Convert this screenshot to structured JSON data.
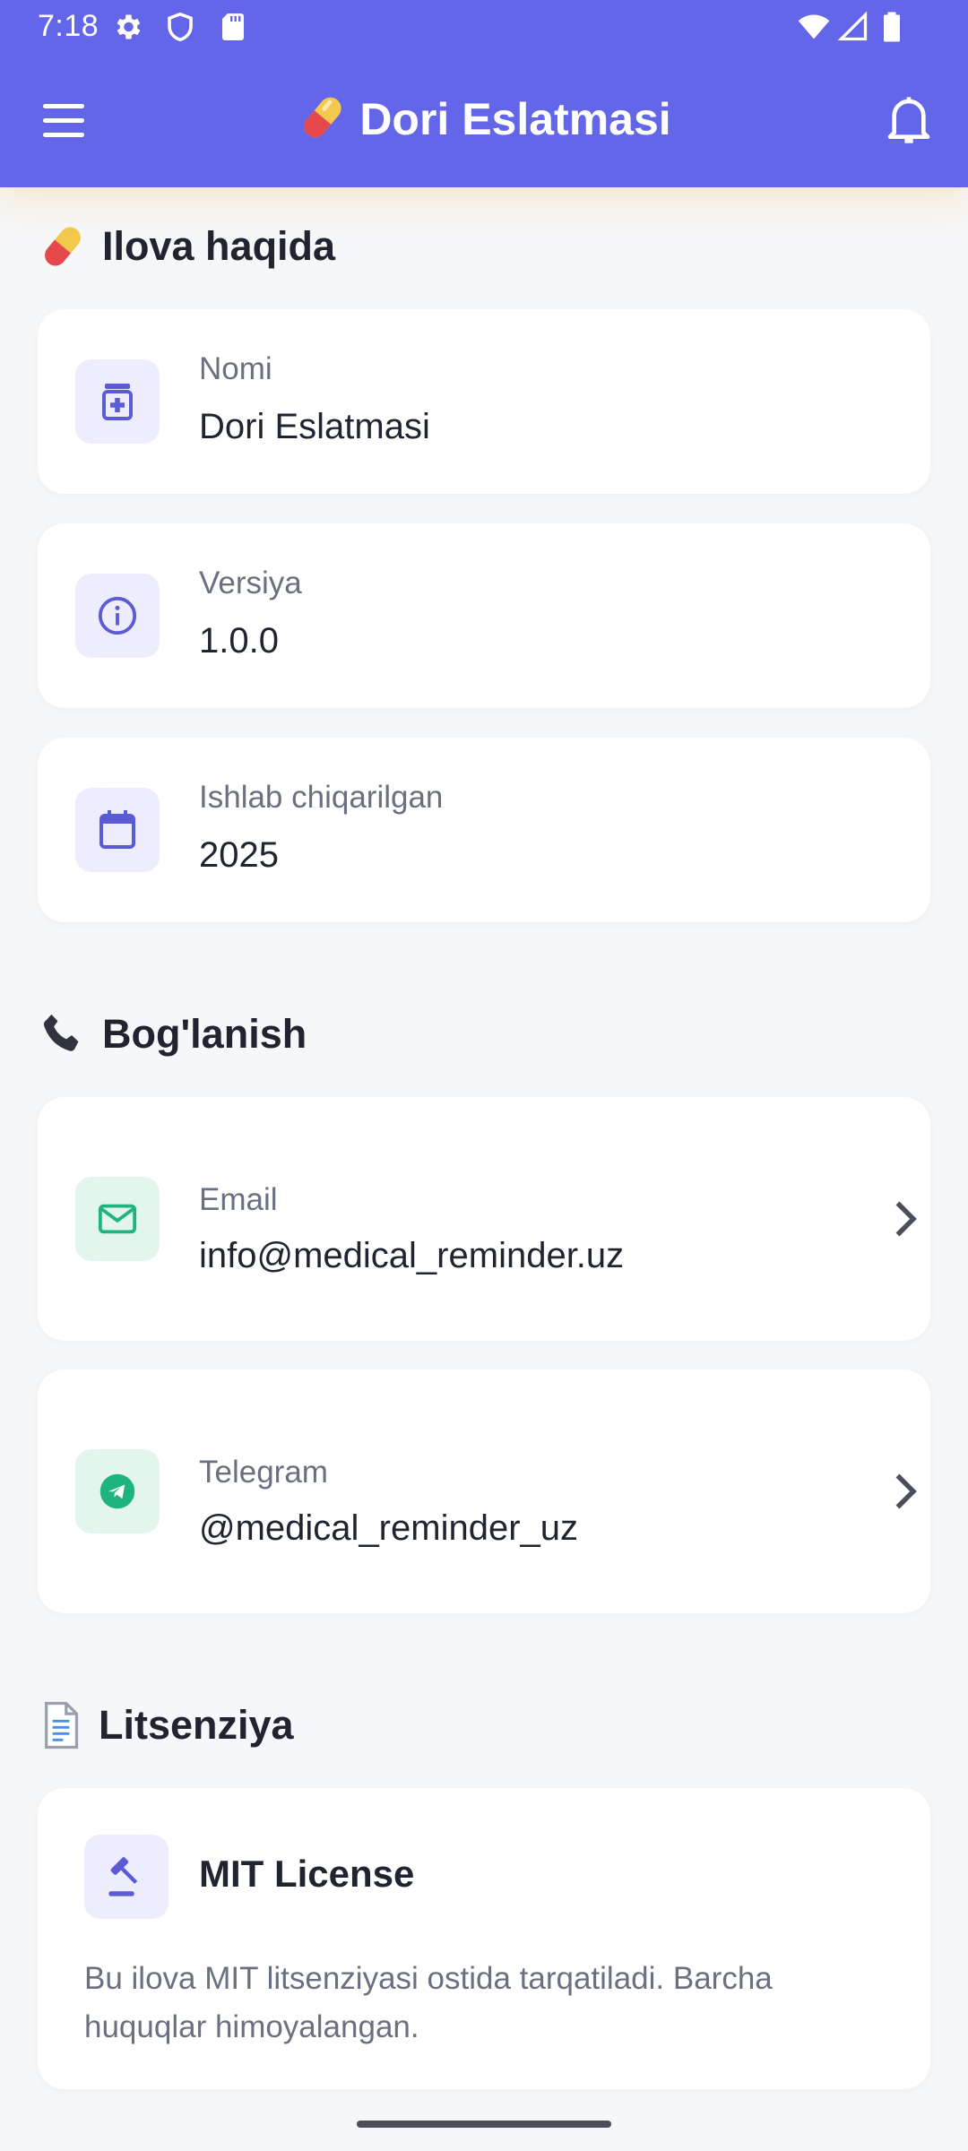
{
  "status_bar": {
    "time": "7:18"
  },
  "app_bar": {
    "title": "Dori Eslatmasi",
    "title_icon": "pill-icon",
    "menu_icon": "hamburger-menu-icon",
    "notification_icon": "bell-icon"
  },
  "about": {
    "title": "Ilova haqida",
    "items": [
      {
        "label": "Nomi",
        "value": "Dori Eslatmasi",
        "icon": "medication-icon"
      },
      {
        "label": "Versiya",
        "value": "1.0.0",
        "icon": "info-icon"
      },
      {
        "label": "Ishlab chiqarilgan",
        "value": "2025",
        "icon": "calendar-icon"
      }
    ]
  },
  "contact": {
    "title": "Bog'lanish",
    "items": [
      {
        "label": "Email",
        "value": "info@medical_reminder.uz",
        "icon": "mail-icon"
      },
      {
        "label": "Telegram",
        "value": "@medical_reminder_uz",
        "icon": "telegram-icon"
      }
    ]
  },
  "license": {
    "title": "Litsenziya",
    "name": "MIT License",
    "description": "Bu ilova MIT litsenziyasi ostida tarqatiladi. Barcha huquqlar himoyalangan.",
    "icon": "gavel-icon"
  },
  "colors": {
    "primary": "#6366E8",
    "accent_green": "#1FB47E",
    "background": "#F6F7F9",
    "card": "#FFFFFF"
  }
}
